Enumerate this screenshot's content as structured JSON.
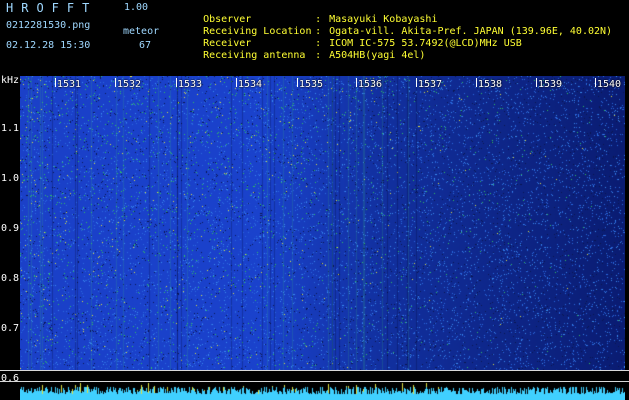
{
  "header": {
    "app_title": "HROFFT",
    "app_version": "1.00",
    "file_name": "0212281530.png",
    "date_time": "02.12.28 15:30",
    "detect_label": "meteor",
    "detect_count": "67",
    "meta": [
      {
        "key": "Observer",
        "sep": ":",
        "value": "Masayuki Kobayashi"
      },
      {
        "key": "Receiving Location",
        "sep": ":",
        "value": "Ogata-vill. Akita-Pref. JAPAN (139.96E, 40.02N)"
      },
      {
        "key": "Receiver",
        "sep": ":",
        "value": "ICOM IC-575 53.7492(@LCD)MHz USB"
      },
      {
        "key": "Receiving antenna",
        "sep": ":",
        "value": "A504HB(yagi 4el)"
      }
    ]
  },
  "plot": {
    "y_unit": "kHz",
    "y_ticks": [
      "1.1",
      "1.0",
      "0.9",
      "0.8",
      "0.7",
      "0.6"
    ],
    "time_ticks": [
      "1531",
      "1532",
      "1533",
      "1534",
      "1535",
      "1536",
      "1537",
      "1538",
      "1539",
      "1540"
    ],
    "colors": {
      "background": "#000000",
      "spectrogram_base": "#1a3dc2",
      "signal_green": "#30c060",
      "signal_yellow": "#e0e040",
      "strip_cyan": "#40d0ff"
    }
  }
}
